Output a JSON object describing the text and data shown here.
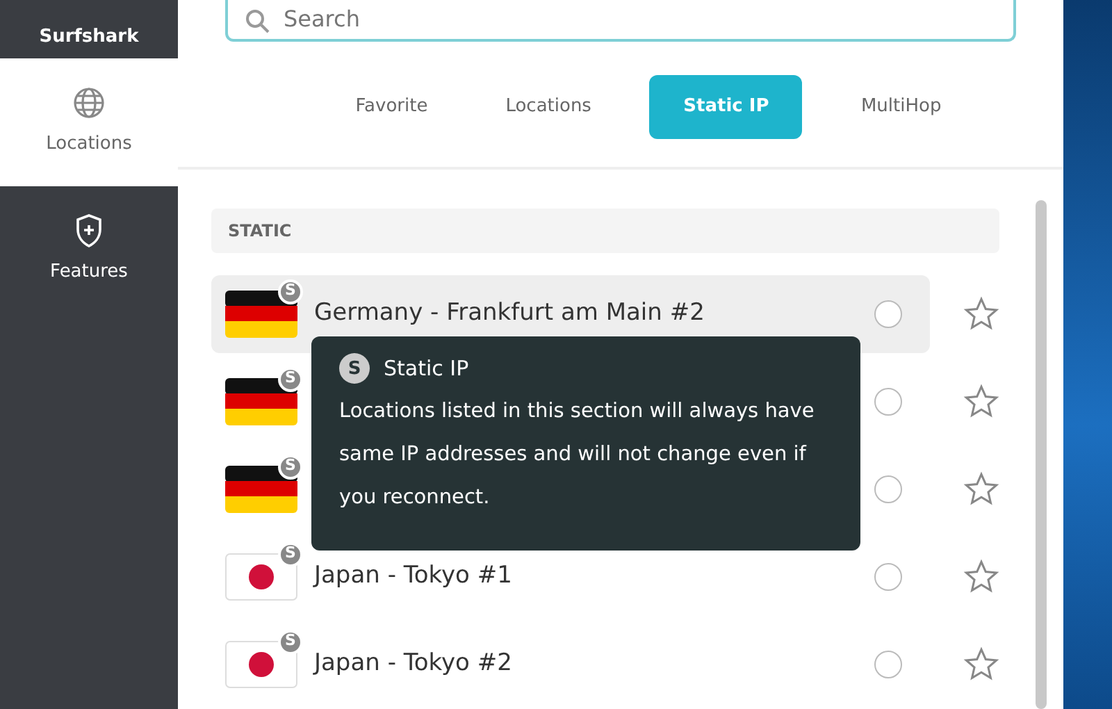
{
  "sidebar": {
    "items": [
      {
        "label": "Surfshark",
        "kind": "brand",
        "selected": false
      },
      {
        "label": "Locations",
        "kind": "locations",
        "selected": true
      },
      {
        "label": "Features",
        "kind": "features",
        "selected": false
      }
    ]
  },
  "search": {
    "placeholder": "Search"
  },
  "tabs": [
    {
      "label": "Favorite",
      "selected": false
    },
    {
      "label": "Locations",
      "selected": false
    },
    {
      "label": "Static IP",
      "selected": true
    },
    {
      "label": "MultiHop",
      "selected": false
    }
  ],
  "section": {
    "title": "STATIC"
  },
  "locations": [
    {
      "kind": "germany",
      "name": "Germany - Frankfurt am Main #2",
      "badge": "S",
      "highlighted": true,
      "connected": false,
      "favorite": false
    },
    {
      "kind": "germany",
      "badge": "S",
      "highlighted": false,
      "connected": false,
      "favorite": false
    },
    {
      "kind": "germany",
      "badge": "S",
      "highlighted": false,
      "connected": false,
      "favorite": false
    },
    {
      "kind": "japan",
      "name": "Japan - Tokyo #1",
      "badge": "S",
      "highlighted": false,
      "connected": false,
      "favorite": false
    },
    {
      "kind": "japan",
      "name": "Japan - Tokyo #2",
      "badge": "S",
      "highlighted": false,
      "connected": false,
      "favorite": false
    }
  ],
  "tooltip": {
    "badge": "S",
    "title": "Static IP",
    "text": "Locations listed in this section will always have same IP addresses and  will not change even if you reconnect."
  }
}
